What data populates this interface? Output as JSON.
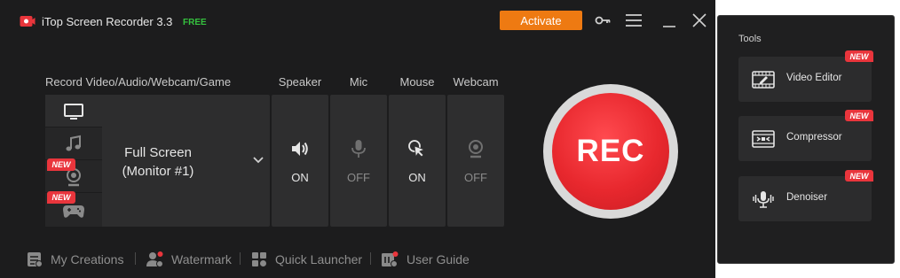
{
  "app": {
    "title": "iTop Screen Recorder 3.3",
    "badge": "FREE"
  },
  "titlebar": {
    "activate_label": "Activate",
    "icons": [
      "key-icon",
      "menu-icon",
      "minimize-icon",
      "close-icon"
    ]
  },
  "headers": {
    "record": "Record Video/Audio/Webcam/Game",
    "speaker": "Speaker",
    "mic": "Mic",
    "mouse": "Mouse",
    "webcam": "Webcam"
  },
  "modes": [
    {
      "icon": "monitor-icon",
      "active": true
    },
    {
      "icon": "music-note-icon",
      "active": false
    },
    {
      "icon": "webcam-icon",
      "active": false,
      "tag": "NEW"
    },
    {
      "icon": "gamepad-icon",
      "active": false,
      "tag": "NEW"
    }
  ],
  "source": {
    "line1": "Full Screen",
    "line2": "(Monitor #1)"
  },
  "toggles": {
    "speaker": "ON",
    "mic": "OFF",
    "mouse": "ON",
    "webcam": "OFF"
  },
  "rec_label": "REC",
  "footer": [
    {
      "label": "My Creations",
      "icon": "creations-icon"
    },
    {
      "label": "Watermark",
      "icon": "watermark-icon"
    },
    {
      "label": "Quick Launcher",
      "icon": "launcher-icon"
    },
    {
      "label": "User Guide",
      "icon": "guide-icon"
    }
  ],
  "tools": {
    "title": "Tools",
    "items": [
      {
        "label": "Video Editor",
        "tag": "NEW",
        "icon": "video-editor-icon"
      },
      {
        "label": "Compressor",
        "tag": "NEW",
        "icon": "compressor-icon"
      },
      {
        "label": "Denoiser",
        "tag": "NEW",
        "icon": "denoiser-icon"
      }
    ]
  },
  "colors": {
    "accent": "#ee7a12",
    "rec": "#e8282e",
    "new_tag": "#e9353c",
    "free": "#35c23f"
  }
}
